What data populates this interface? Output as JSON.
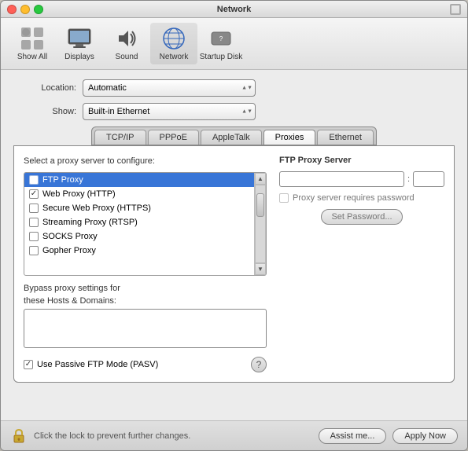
{
  "window": {
    "title": "Network"
  },
  "toolbar": {
    "items": [
      {
        "id": "show-all",
        "label": "Show All",
        "icon": "grid"
      },
      {
        "id": "displays",
        "label": "Displays",
        "icon": "monitor"
      },
      {
        "id": "sound",
        "label": "Sound",
        "icon": "speaker"
      },
      {
        "id": "network",
        "label": "Network",
        "icon": "globe",
        "active": true
      },
      {
        "id": "startup-disk",
        "label": "Startup Disk",
        "icon": "disk"
      }
    ]
  },
  "location": {
    "label": "Location:",
    "value": "Automatic"
  },
  "show": {
    "label": "Show:",
    "value": "Built-in Ethernet"
  },
  "tabs": [
    {
      "id": "tcpip",
      "label": "TCP/IP"
    },
    {
      "id": "pppoe",
      "label": "PPPoE"
    },
    {
      "id": "appletalk",
      "label": "AppleTalk"
    },
    {
      "id": "proxies",
      "label": "Proxies",
      "active": true
    },
    {
      "id": "ethernet",
      "label": "Ethernet"
    }
  ],
  "panel": {
    "proxy_list_label": "Select a proxy server to configure:",
    "proxy_items": [
      {
        "id": "ftp",
        "label": "FTP Proxy",
        "checked": true,
        "active": true
      },
      {
        "id": "web",
        "label": "Web Proxy (HTTP)",
        "checked": true
      },
      {
        "id": "secure-web",
        "label": "Secure Web Proxy (HTTPS)",
        "checked": false
      },
      {
        "id": "streaming",
        "label": "Streaming Proxy (RTSP)",
        "checked": false
      },
      {
        "id": "socks",
        "label": "SOCKS Proxy",
        "checked": false
      },
      {
        "id": "gopher",
        "label": "Gopher Proxy",
        "checked": false
      }
    ],
    "ftp_proxy": {
      "title": "FTP Proxy Server",
      "server_value": "",
      "port_value": "",
      "colon": ":",
      "requires_password_label": "Proxy server requires password",
      "set_password_label": "Set Password..."
    },
    "bypass": {
      "label1": "Bypass proxy settings for",
      "label2": "these Hosts & Domains:",
      "value": ""
    },
    "pasv": {
      "label": "Use Passive FTP Mode (PASV)",
      "checked": true
    },
    "help_icon": "?"
  },
  "status_bar": {
    "lock_text": "Click the lock to prevent further changes.",
    "assist_label": "Assist me...",
    "apply_label": "Apply Now"
  }
}
